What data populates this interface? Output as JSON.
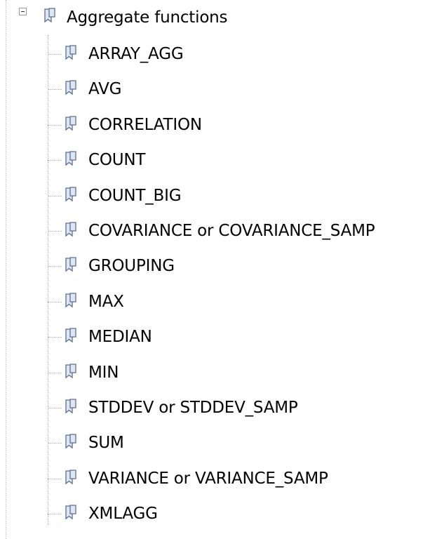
{
  "tree": {
    "root": {
      "label": "Aggregate functions",
      "expanded": true,
      "icon": "book-icon"
    },
    "children": [
      {
        "label": "ARRAY_AGG",
        "icon": "book-icon"
      },
      {
        "label": "AVG",
        "icon": "book-icon"
      },
      {
        "label": "CORRELATION",
        "icon": "book-icon"
      },
      {
        "label": "COUNT",
        "icon": "book-icon"
      },
      {
        "label": "COUNT_BIG",
        "icon": "book-icon"
      },
      {
        "label": "COVARIANCE or COVARIANCE_SAMP",
        "icon": "book-icon"
      },
      {
        "label": "GROUPING",
        "icon": "book-icon"
      },
      {
        "label": "MAX",
        "icon": "book-icon"
      },
      {
        "label": "MEDIAN",
        "icon": "book-icon"
      },
      {
        "label": "MIN",
        "icon": "book-icon"
      },
      {
        "label": "STDDEV or STDDEV_SAMP",
        "icon": "book-icon"
      },
      {
        "label": "SUM",
        "icon": "book-icon"
      },
      {
        "label": "VARIANCE or VARIANCE_SAMP",
        "icon": "book-icon"
      },
      {
        "label": "XMLAGG",
        "icon": "book-icon"
      }
    ]
  },
  "colors": {
    "book_fill": "#dfe6f3",
    "book_stroke": "#5e6f8f",
    "guide_line": "#a9a9a9"
  }
}
